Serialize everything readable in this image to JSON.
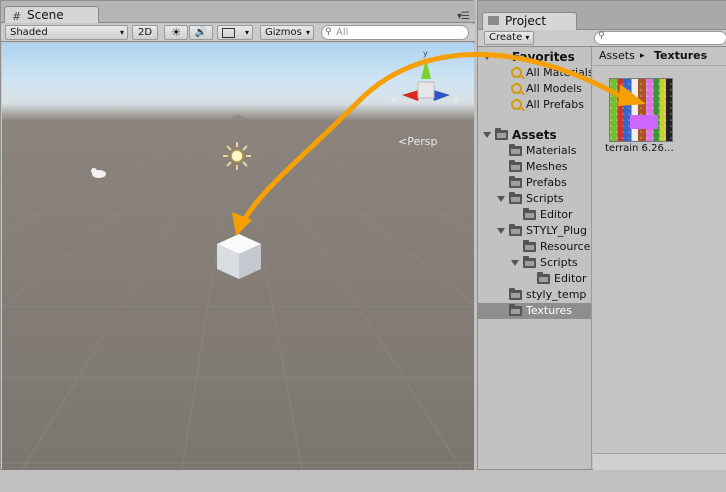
{
  "scene_tab": {
    "label": "Scene",
    "icon": "grid-icon"
  },
  "scene_toolbar": {
    "shading_mode": "Shaded",
    "mode_2d": "2D",
    "gizmos": "Gizmos",
    "search_placeholder": "All"
  },
  "viewport": {
    "persp_label": "Persp"
  },
  "project_tab": {
    "label": "Project",
    "icon": "folder-icon"
  },
  "project_toolbar": {
    "create_label": "Create"
  },
  "tree": {
    "favorites": "Favorites",
    "favorite_items": [
      "All Materials",
      "All Models",
      "All Prefabs"
    ],
    "assets": "Assets",
    "folders": {
      "materials": "Materials",
      "meshes": "Meshes",
      "prefabs": "Prefabs",
      "scripts": "Scripts",
      "editor": "Editor",
      "styly_plug": "STYLY_Plug",
      "resources": "Resource",
      "styly_scripts": "Scripts",
      "styly_editor": "Editor",
      "styly_temp": "styly_temp",
      "textures": "Textures"
    }
  },
  "content": {
    "breadcrumb_root": "Assets",
    "breadcrumb_sep": "▸",
    "breadcrumb_current": "Textures",
    "asset_label": "terrain 6.26…"
  },
  "colors": {
    "drag_arrow": "#f5a000",
    "selection": "#8e8e8e"
  }
}
